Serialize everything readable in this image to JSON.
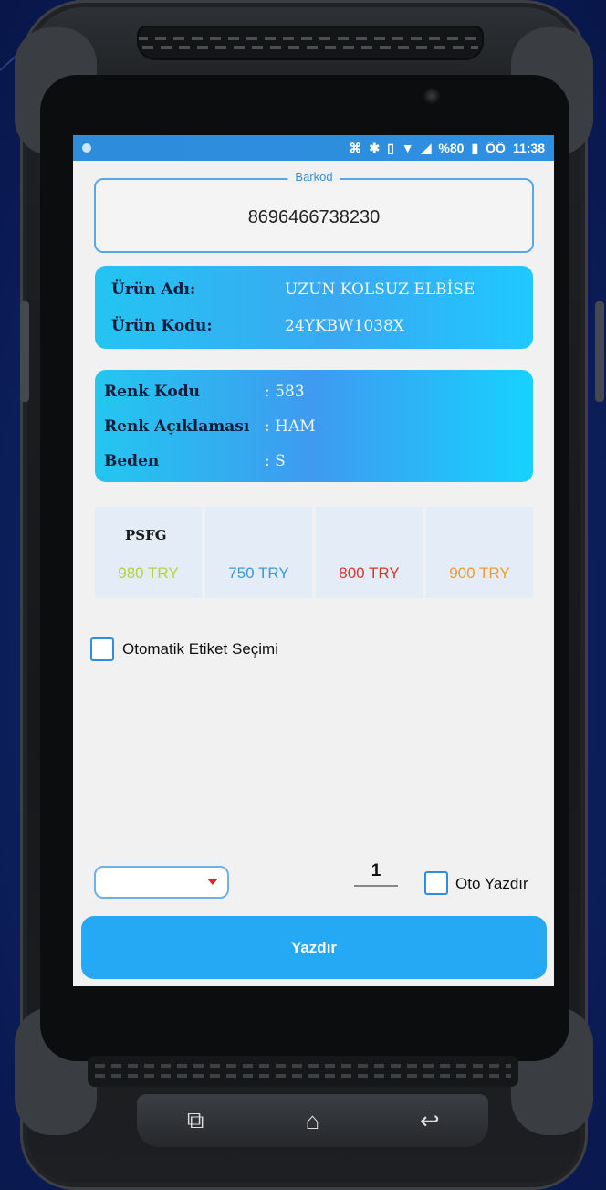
{
  "status_bar": {
    "battery": "%80",
    "time": "11:38",
    "misc": "ÖÖ"
  },
  "barcode": {
    "label": "Barkod",
    "value": "8696466738230"
  },
  "product": {
    "name_label": "Ürün Adı:",
    "name_value": "UZUN KOLSUZ ELBİSE",
    "code_label": "Ürün Kodu:",
    "code_value": "24YKBW1038X"
  },
  "variant": {
    "color_code_label": "Renk Kodu",
    "color_code_value": ": 583",
    "color_desc_label": "Renk Açıklaması",
    "color_desc_value": ": HAM",
    "size_label": "Beden",
    "size_value": ": S"
  },
  "prices": {
    "header": "PSFG",
    "items": [
      {
        "text": "980 TRY",
        "color": "#b5d33d"
      },
      {
        "text": "750 TRY",
        "color": "#3a9ad8"
      },
      {
        "text": "800 TRY",
        "color": "#e0342c"
      },
      {
        "text": "900 TRY",
        "color": "#f29a2e"
      }
    ]
  },
  "auto_label": {
    "label": "Otomatik Etiket Seçimi",
    "checked": false
  },
  "footer": {
    "quantity": "1",
    "auto_print_label": "Oto Yazdır",
    "auto_print_checked": false,
    "print_button": "Yazdır",
    "dropdown_value": ""
  },
  "nav": {
    "recent_icon": "recent-apps-icon",
    "home_icon": "home-icon",
    "back_icon": "back-icon"
  }
}
